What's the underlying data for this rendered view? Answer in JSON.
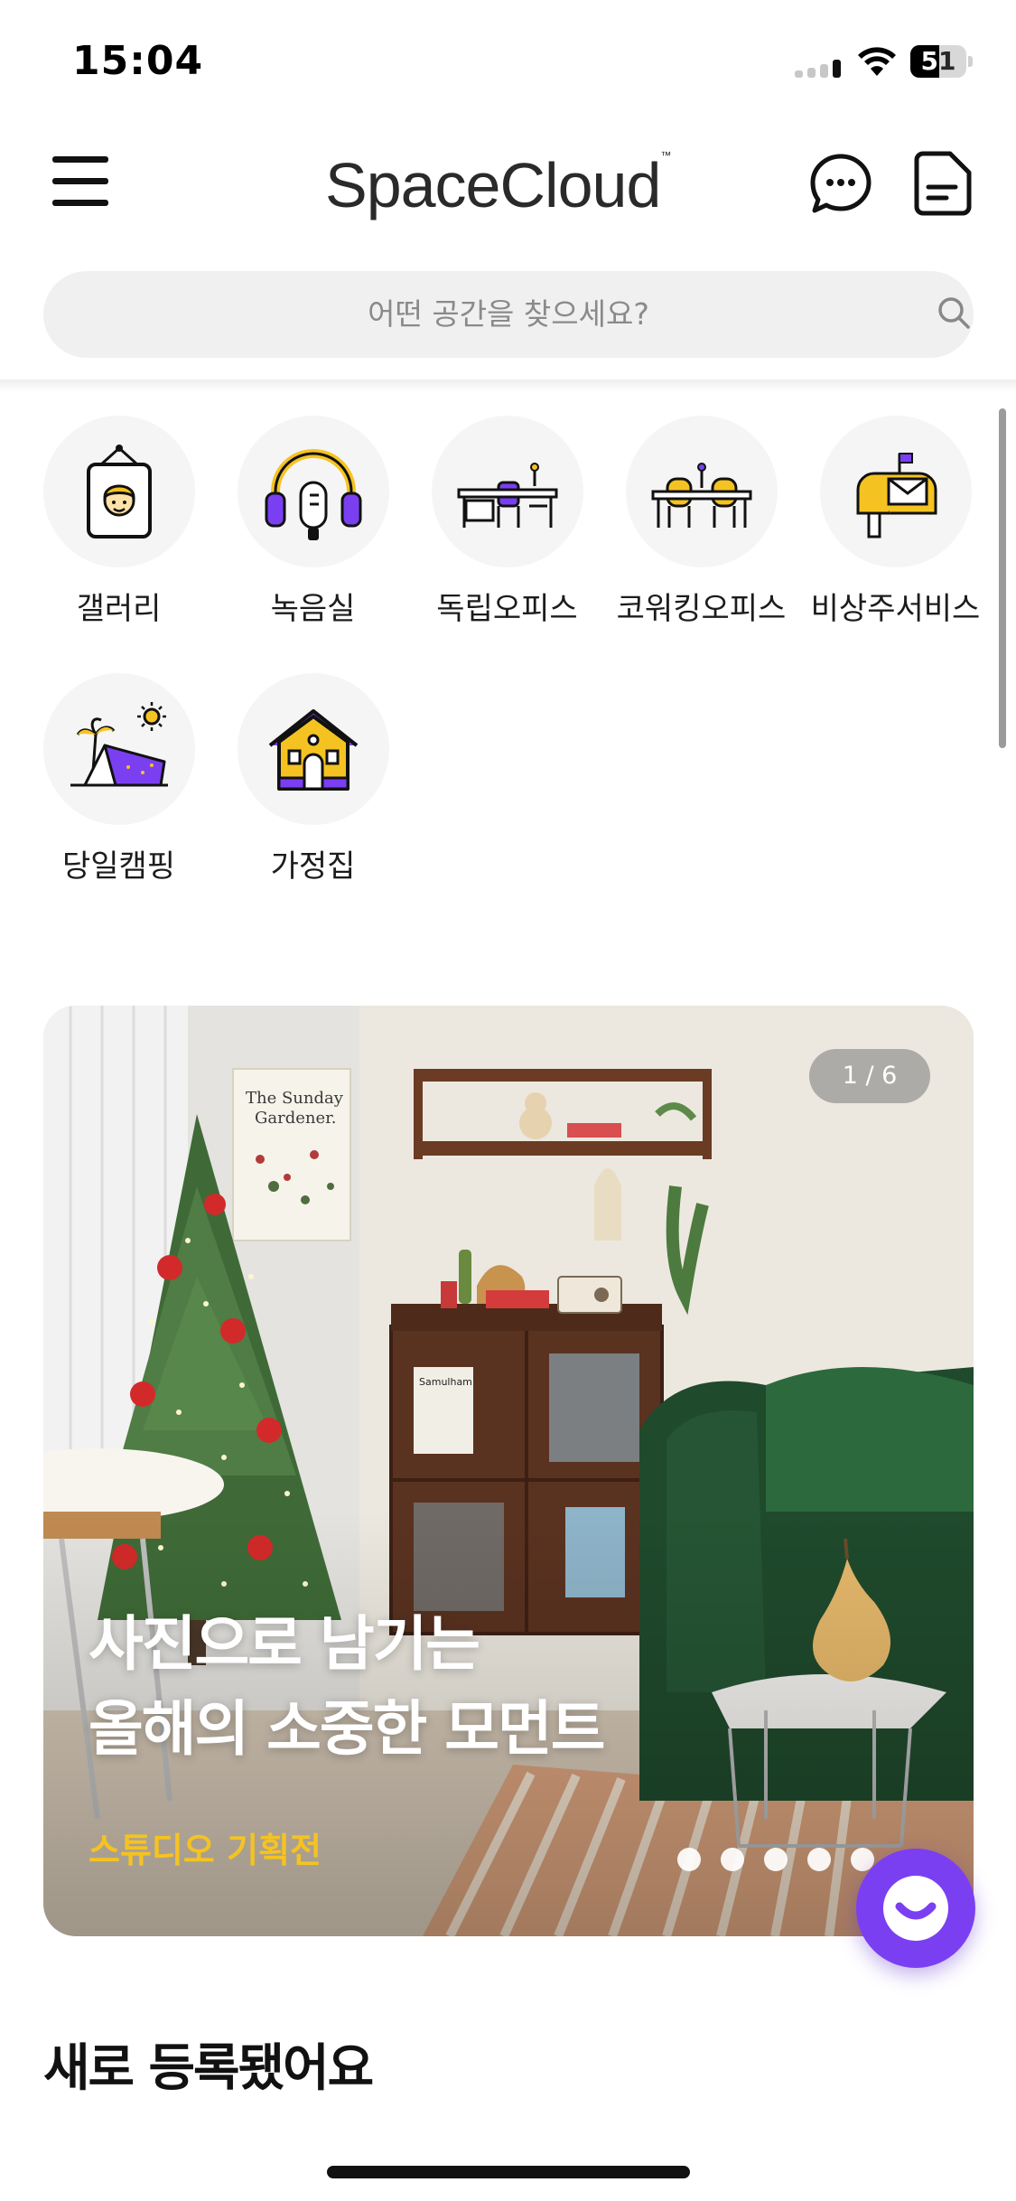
{
  "status_bar": {
    "time": "15:04",
    "battery_level": "51",
    "icons": [
      "cellular-signal-icon",
      "wifi-icon",
      "battery-icon"
    ]
  },
  "header": {
    "logo": "SpaceCloud",
    "logo_mark": "™",
    "icons": [
      "menu-icon",
      "chat-bubble-icon",
      "document-icon"
    ]
  },
  "search": {
    "placeholder": "어떤 공간을 찾으세요?",
    "icon": "search-icon"
  },
  "categories": [
    {
      "label": "갤러리",
      "icon": "gallery-frame-icon"
    },
    {
      "label": "녹음실",
      "icon": "headphones-mic-icon"
    },
    {
      "label": "독립오피스",
      "icon": "office-desk-icon"
    },
    {
      "label": "코워킹오피스",
      "icon": "coworking-desk-icon"
    },
    {
      "label": "비상주서비스",
      "icon": "mailbox-icon"
    },
    {
      "label": "당일캠핑",
      "icon": "camping-tent-icon"
    },
    {
      "label": "가정집",
      "icon": "house-icon"
    }
  ],
  "banner": {
    "counter": "1 / 6",
    "title_line1": "사진으로 남기는",
    "title_line2": "올해의 소중한 모먼트",
    "subtitle": "스튜디오 기획전",
    "poster_text_line1": "The Sunday",
    "poster_text_line2": "Gardener.",
    "book_label": "Samulham",
    "dots": 5,
    "active_dot": 0
  },
  "section": {
    "title": "새로 등록됐어요"
  },
  "colors": {
    "accent_purple": "#7b3ff2",
    "accent_yellow": "#f5c321",
    "icon_bg": "#f5f5f5",
    "search_bg": "#f0f0f0"
  }
}
